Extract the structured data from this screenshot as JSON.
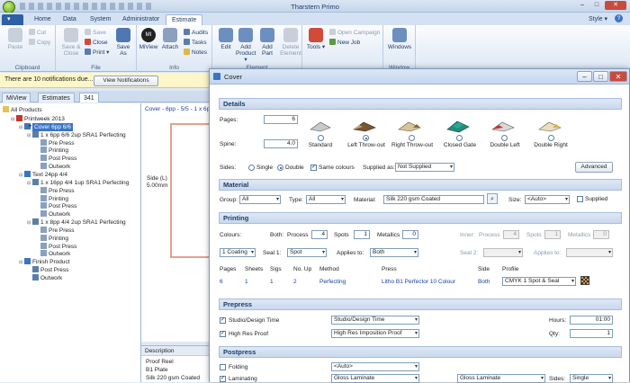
{
  "app": {
    "title": "Tharstern Primo",
    "style_label": "Style"
  },
  "ribbon_tabs": [
    "Home",
    "Data",
    "System",
    "Administrator",
    "Estimate"
  ],
  "ribbon": {
    "clipboard": {
      "paste": "Paste",
      "cut": "Cut",
      "copy": "Copy",
      "label": "Clipboard"
    },
    "file": {
      "save_close": "Save & Close",
      "save": "Save",
      "close": "Close",
      "print": "Print",
      "save_as": "Save As",
      "label": "File"
    },
    "info": {
      "miview": "MiView",
      "attach": "Attach",
      "audits": "Audits",
      "tasks": "Tasks",
      "notes": "Notes",
      "label": "Info"
    },
    "element": {
      "edit": "Edit",
      "add_product": "Add Product",
      "add_part": "Add Part",
      "delete_element": "Delete Element",
      "label": "Element"
    },
    "tools": {
      "tools": "Tools",
      "open_campaign": "Open Campaign",
      "new_job": "New Job"
    },
    "window": {
      "windows": "Windows",
      "label": "Window"
    }
  },
  "notification": {
    "text": "There are 10 notifications due...",
    "button": "View Notifications"
  },
  "doc_tabs": [
    "MiView",
    "Estimates",
    "341"
  ],
  "tree": {
    "root": "All Products",
    "items": [
      {
        "label": "Printweek 2013",
        "level": 1
      },
      {
        "label": "Cover 6pp 6/6",
        "level": 2,
        "selected": true
      },
      {
        "label": "1 x 6pp 6/6 2up SRA1 Perfecting",
        "level": 3
      },
      {
        "label": "Pre Press",
        "level": 4
      },
      {
        "label": "Printing",
        "level": 4
      },
      {
        "label": "Post Press",
        "level": 4
      },
      {
        "label": "Outwork",
        "level": 4
      },
      {
        "label": "Text 24pp 4/4",
        "level": 2
      },
      {
        "label": "1 x 16pp 4/4 1up SRA1 Perfecting",
        "level": 3
      },
      {
        "label": "Pre Press",
        "level": 4
      },
      {
        "label": "Printing",
        "level": 4
      },
      {
        "label": "Post Press",
        "level": 4
      },
      {
        "label": "Outwork",
        "level": 4
      },
      {
        "label": "1 x 8pp 4/4 2up SRA1 Perfecting",
        "level": 3
      },
      {
        "label": "Pre Press",
        "level": 4
      },
      {
        "label": "Printing",
        "level": 4
      },
      {
        "label": "Post Press",
        "level": 4
      },
      {
        "label": "Outwork",
        "level": 4
      },
      {
        "label": "Finish Product",
        "level": 2
      },
      {
        "label": "Post Press",
        "level": 3
      },
      {
        "label": "Outwork",
        "level": 3
      }
    ]
  },
  "canvas": {
    "header": "Cover - 6pp - 5/5 - 1 x 6pp",
    "side_label": "Side (L)",
    "side_value": "5.00mm"
  },
  "description": {
    "header": "Description",
    "lines": [
      "Proof Reel",
      "B1 Plate",
      "Silk 220 gsm Coated"
    ]
  },
  "window": {
    "title": "Cover",
    "details": {
      "heading": "Details",
      "pages_label": "Pages:",
      "pages_value": "6",
      "spine_label": "Spine:",
      "spine_value": "4.0",
      "bindings": [
        "Standard",
        "Left Throw-out",
        "Right Throw-out",
        "Closed Gate",
        "Double Left",
        "Double Right"
      ],
      "selected_binding": 1,
      "sides_label": "Sides:",
      "single": "Single",
      "double": "Double",
      "same_colours": "Same colours",
      "supplied_as_label": "Supplied as:",
      "supplied_as_value": "Not Supplied",
      "advanced": "Advanced"
    },
    "material": {
      "heading": "Material",
      "group_label": "Group:",
      "group_value": "All",
      "type_label": "Type:",
      "type_value": "All",
      "material_label": "Material:",
      "material_value": "Silk 220 gsm Coated",
      "size_label": "Size:",
      "size_value": "<Auto>",
      "supplied": "Supplied"
    },
    "printing": {
      "heading": "Printing",
      "colours_label": "Colours:",
      "both": "Both:",
      "process": "Process",
      "process_value": "4",
      "spots": "Spots",
      "spots_value": "1",
      "metallics": "Metallics",
      "metallics_value": "0",
      "inner": "Inner:",
      "inner_process_value": "4",
      "inner_spots_value": "1",
      "inner_metallics_value": "0",
      "coating_value": "1 Coating",
      "seal1_label": "Seal 1:",
      "seal1_value": "Spot",
      "applies_to_label": "Applies to:",
      "applies_to_value": "Both",
      "seal2_label": "Seal 2:",
      "applies_to2_label": "Applies to:",
      "columns": [
        "Pages",
        "Sheets",
        "Sigs",
        "No. Up",
        "Method",
        "Press",
        "Side",
        "Profile"
      ],
      "row": [
        "6",
        "1",
        "1",
        "2",
        "Perfecting",
        "Litho B1 Perfector 10 Colour",
        "Both",
        "CMYK 1 Spot & Seal"
      ]
    },
    "prepress": {
      "heading": "Prepress",
      "items": [
        {
          "label": "Studio/Design Time",
          "value": "Studio/Design Time"
        },
        {
          "label": "High Res Proof",
          "value": "High Res Imposition Proof"
        }
      ],
      "hours_label": "Hours:",
      "hours_value": "01:00",
      "qty_label": "Qty:",
      "qty_value": "1"
    },
    "postpress": {
      "heading": "Postpress",
      "folding_label": "Folding",
      "folding_value": "<Auto>",
      "laminating_label": "Laminating",
      "laminating_value1": "Gloss Laminate",
      "laminating_value2": "Gloss Laminate",
      "sides_label": "Sides:",
      "sides_value": "Single"
    }
  },
  "colors": {
    "accent": "#3b74c5",
    "ribbon": "#dce7f5",
    "header": "#c8d8ee"
  }
}
